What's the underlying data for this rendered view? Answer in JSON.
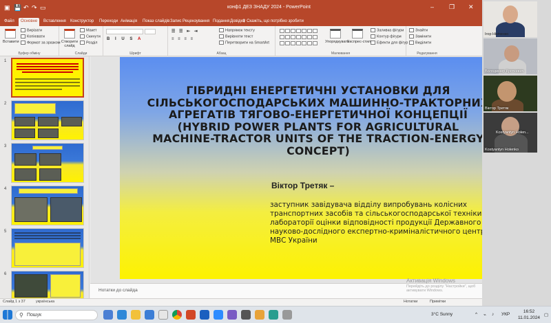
{
  "window": {
    "doc_title": "конф1 ДЕЗ ЗНАДУ 2024 - PowerPoint",
    "buttons": [
      "–",
      "❐",
      "✕"
    ]
  },
  "ribbon_tabs": [
    {
      "label": "Файл"
    },
    {
      "label": "Основне"
    },
    {
      "label": "Вставлення"
    },
    {
      "label": "Конструктор"
    },
    {
      "label": "Переходи"
    },
    {
      "label": "Анімація"
    },
    {
      "label": "Показ слайдів"
    },
    {
      "label": "Запис"
    },
    {
      "label": "Рецензування"
    },
    {
      "label": "Подання"
    },
    {
      "label": "Довідка"
    }
  ],
  "tell_me": "Скажіть, що потрібно зробити",
  "ribbon": {
    "clipboard": {
      "paste": "Вставити",
      "cut": "Вирізати",
      "copy": "Копіювати",
      "format": "Формат за зразком",
      "label": "Буфер обміну"
    },
    "slides": {
      "new": "Створити слайд",
      "layout": "Макет",
      "reset": "Скинути",
      "section": "Розділ",
      "label": "Слайди"
    },
    "font": {
      "label": "Шрифт"
    },
    "paragraph": {
      "text_dir": "Напрямок тексту",
      "align": "Вирівняти текст",
      "smartart": "Перетворити на SmartArt",
      "label": "Абзац"
    },
    "drawing": {
      "arrange": "Упорядкувати",
      "styles": "Експрес-стилі",
      "fill": "Заливка фігури",
      "outline": "Контур фігури",
      "effects": "Ефекти для фігур",
      "label": "Малювання"
    },
    "editing": {
      "find": "Знайти",
      "replace": "Замінити",
      "select": "Виділити",
      "label": "Редагування"
    }
  },
  "thumbnails": [
    {
      "num": "1"
    },
    {
      "num": "2"
    },
    {
      "num": "3"
    },
    {
      "num": "4"
    },
    {
      "num": "5"
    },
    {
      "num": "6"
    }
  ],
  "slide": {
    "title": "ГІБРИДНІ ЕНЕРГЕТИЧНІ УСТАНОВКИ ДЛЯ СІЛЬСЬКОГОСПОДАРСЬКИХ МАШИННО-ТРАКТОРНИХ АГРЕГАТІВ ТЯГОВО-ЕНЕРГЕТИЧНОЇ КОНЦЕПЦІЇ (HYBRID POWER PLANTS FOR AGRICULTURAL MACHINE-TRACTOR UNITS OF THE TRACTION-ENERGY CONCEPT)",
    "author": "Віктор Третяк –",
    "description": "заступник завідувача відділу випробувань колісних транспортних засобів та сільськогосподарської техніки лабораторії оцінки відповідності продукції Державного науково-дослідного експертно-криміналістичного центру МВС України"
  },
  "notes_placeholder": "Нотатки до слайда",
  "status": {
    "slide": "Слайд 1 з 37",
    "lang": "українська",
    "notes": "Нотатки",
    "comments": "Примітки"
  },
  "watermark": {
    "title": "Активація Windows",
    "subtitle": "Перейдіть до розділу \"Настройки\", щоб активувати Windows."
  },
  "participants": [
    {
      "name": "Ігор Нікіченко"
    },
    {
      "name": "Володимир Кроткевич"
    },
    {
      "name": "Віктор Третяк"
    },
    {
      "name": "Kostyantyn Holen..."
    },
    {
      "name": "Kostyantyn Holenko"
    }
  ],
  "taskbar": {
    "search": "Пошук",
    "weather": "3°C Sunny",
    "lang": "УКР",
    "time": "16:52",
    "date": "11.01.2024"
  },
  "colors": {
    "accent": "#b7472a",
    "slide_top": "#5b8ef0",
    "slide_bottom": "#fdf200"
  }
}
